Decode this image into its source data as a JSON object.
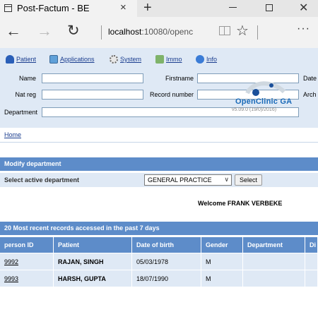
{
  "browser": {
    "tab_title": "Post-Factum - BE",
    "tab_close": "×",
    "new_tab": "+",
    "address_host": "localhost",
    "address_rest": ":10080/openc",
    "back_glyph": "←",
    "forward_glyph": "→",
    "refresh_glyph": "↻",
    "star_glyph": "☆",
    "more_glyph": "···",
    "close_glyph": "✕"
  },
  "menu": [
    {
      "label": "Patient",
      "icon": "patient-icon"
    },
    {
      "label": "Applications",
      "icon": "applications-icon"
    },
    {
      "label": "System",
      "icon": "system-icon"
    },
    {
      "label": "Immo",
      "icon": "immo-icon"
    },
    {
      "label": "Info",
      "icon": "info-icon"
    }
  ],
  "search": {
    "name_label": "Name",
    "firstname_label": "Firstname",
    "date_label": "Date",
    "natreg_label": "Nat reg",
    "record_label": "Record number",
    "arch_label": "Arch",
    "department_label": "Department"
  },
  "logo": {
    "text": "OpenClinic GA",
    "version": "v5.09.0 (19/0)/2016)"
  },
  "breadcrumb": {
    "home": "Home"
  },
  "modify_department": {
    "title": "Modify department",
    "select_label": "Select active department",
    "selected_value": "GENERAL PRACTICE",
    "button_label": "Select"
  },
  "welcome": "Welcome FRANK VERBEKE",
  "recent": {
    "title": "20 Most recent records accessed in the past 7 days",
    "columns": [
      "person ID",
      "Patient",
      "Date of birth",
      "Gender",
      "Department",
      "Di"
    ],
    "rows": [
      {
        "id": "9992",
        "patient": "RAJAN, SINGH",
        "dob": "05/03/1978",
        "gender": "M",
        "department": "",
        "di": ""
      },
      {
        "id": "9993",
        "patient": "HARSH, GUPTA",
        "dob": "18/07/1990",
        "gender": "M",
        "department": "",
        "di": ""
      }
    ]
  },
  "colors": {
    "header_bg": "#dfe9f5",
    "section_head": "#5d8cc9",
    "link": "#1a3d8f"
  }
}
